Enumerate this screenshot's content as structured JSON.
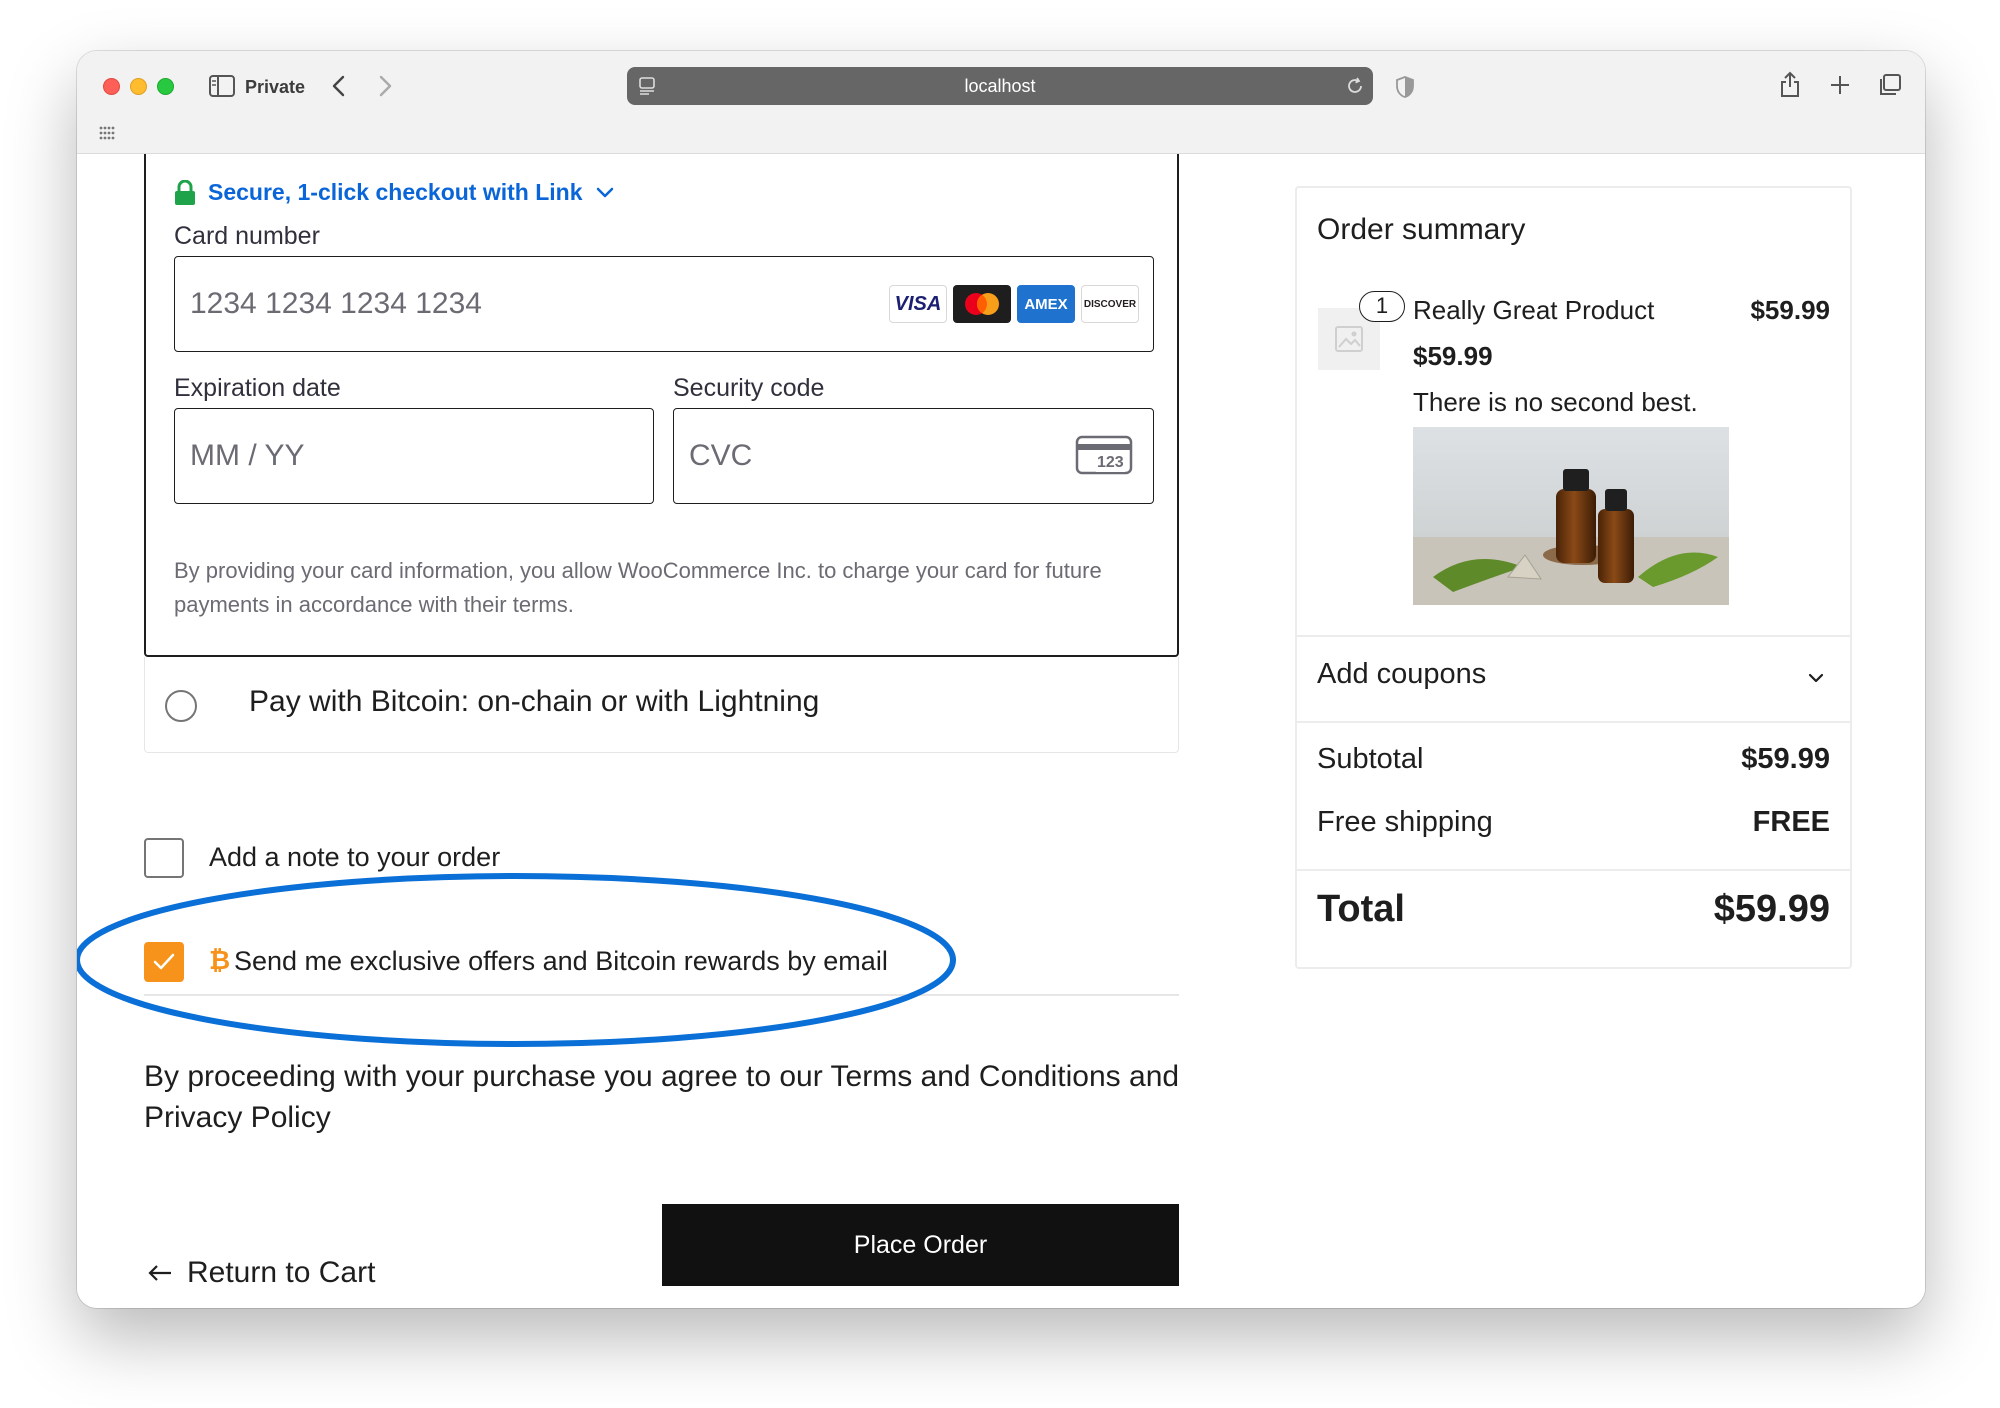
{
  "browser": {
    "private_label": "Private",
    "url": "localhost"
  },
  "payment": {
    "link_label": "Secure, 1-click checkout with Link",
    "card_number_label": "Card number",
    "card_number_placeholder": "1234 1234 1234 1234",
    "card_brands": [
      "VISA",
      "mastercard",
      "AMEX",
      "DISCOVER"
    ],
    "expiration_label": "Expiration date",
    "expiration_placeholder": "MM / YY",
    "security_label": "Security code",
    "security_placeholder": "CVC",
    "cvc_icon_text": "123",
    "consent_text": "By providing your card information, you allow WooCommerce Inc. to charge your card for future payments in accordance with their terms.",
    "bitcoin_option_label": "Pay with Bitcoin: on-chain or with Lightning"
  },
  "checkout": {
    "note_label": "Add a note to your order",
    "note_checked": false,
    "offers_label": "Send me exclusive offers and Bitcoin rewards by email",
    "offers_checked": true,
    "offers_icon_glyph": "₿",
    "terms_text": "By proceeding with your purchase you agree to our Terms and Conditions and Privacy Policy",
    "return_label": "Return to Cart",
    "place_order_label": "Place Order"
  },
  "summary": {
    "title": "Order summary",
    "item": {
      "quantity": "1",
      "name": "Really Great Product",
      "line_total": "$59.99",
      "price": "$59.99",
      "description": "There is no second best."
    },
    "coupons_label": "Add coupons",
    "subtotal_label": "Subtotal",
    "subtotal_value": "$59.99",
    "shipping_label": "Free shipping",
    "shipping_value": "FREE",
    "total_label": "Total",
    "total_value": "$59.99"
  },
  "colors": {
    "link_blue": "#0a66d8",
    "bitcoin_orange": "#f7931a",
    "highlight_ellipse": "#0a6fd6",
    "button_black": "#111111"
  }
}
